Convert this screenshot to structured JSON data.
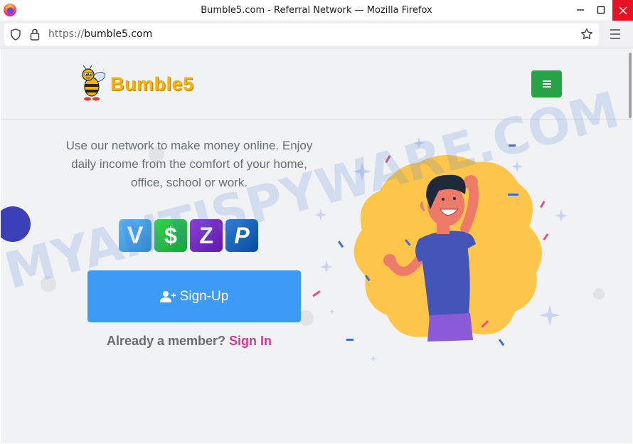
{
  "browser": {
    "window_title": "Bumble5.com - Referral Network — Mozilla Firefox",
    "url_protocol": "https://",
    "url_domain": "bumble5.com",
    "close_color": "#e81123"
  },
  "site": {
    "logo_text": "Bumble5",
    "logo_color": "#f5b400",
    "menu_button_color": "#27a244",
    "tagline": "Use our network to make money online. Enjoy daily income from the comfort of your home, office, school or work.",
    "payments": [
      {
        "name": "venmo",
        "glyph": "V"
      },
      {
        "name": "cash-app",
        "glyph": "$"
      },
      {
        "name": "zelle",
        "glyph": "Z"
      },
      {
        "name": "paypal",
        "glyph": "P"
      }
    ],
    "signup_label": "Sign-Up",
    "signup_color": "#3d9bf5",
    "member_prompt": "Already a member?",
    "signin_label": "Sign In",
    "signin_color": "#e0358e"
  },
  "watermark": "MYANTISPYWARE.COM"
}
